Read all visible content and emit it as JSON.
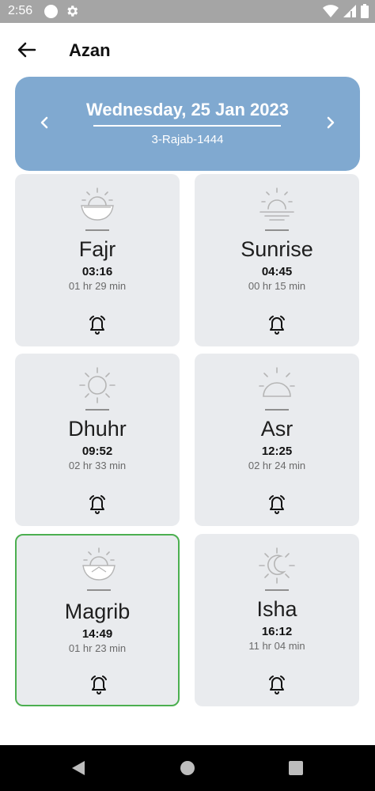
{
  "status_bar": {
    "time": "2:56"
  },
  "header": {
    "title": "Azan"
  },
  "date": {
    "gregorian": "Wednesday, 25 Jan 2023",
    "hijri": "3-Rajab-1444"
  },
  "prayers": [
    {
      "name": "Fajr",
      "time": "03:16",
      "remaining": "01 hr 29 min",
      "icon": "sunrise-bowl-icon"
    },
    {
      "name": "Sunrise",
      "time": "04:45",
      "remaining": "00 hr 15 min",
      "icon": "sun-horizon-icon"
    },
    {
      "name": "Dhuhr",
      "time": "09:52",
      "remaining": "02 hr 33 min",
      "icon": "sun-icon"
    },
    {
      "name": "Asr",
      "time": "12:25",
      "remaining": "02 hr 24 min",
      "icon": "half-sun-icon"
    },
    {
      "name": "Magrib",
      "time": "14:49",
      "remaining": "01 hr 23 min",
      "icon": "sunset-bowl-icon",
      "active": true
    },
    {
      "name": "Isha",
      "time": "16:12",
      "remaining": "11 hr 04 min",
      "icon": "moon-icon"
    }
  ],
  "colors": {
    "header_card": "#80a9d0",
    "card_bg": "#e9ebee",
    "active_border": "#4caf50"
  }
}
